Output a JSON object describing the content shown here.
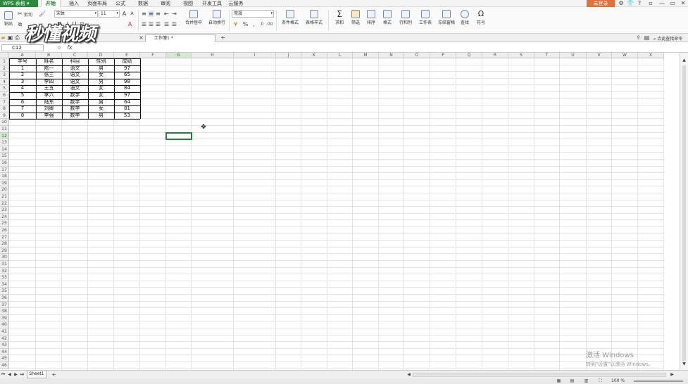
{
  "app": {
    "brand": "WPS 表格",
    "login": "未登录"
  },
  "menu": [
    "开始",
    "插入",
    "页面布局",
    "公式",
    "数据",
    "审阅",
    "视图",
    "开发工具",
    "云服务"
  ],
  "window_controls": [
    "—",
    "▭",
    "✕"
  ],
  "ribbon": {
    "paste": "粘贴",
    "cut": "剪切",
    "copy": "复制",
    "format_painter": "格式刷",
    "font_name": "宋体",
    "font_size": "11",
    "bold": "B",
    "italic": "I",
    "underline": "U",
    "merge_center": "合并居中",
    "auto_wrap": "自动换行",
    "number_format": "常规",
    "percent": "%",
    "conditional_format": "条件格式",
    "table_style": "表格样式",
    "sum": "求和",
    "filter": "筛选",
    "sort": "排序",
    "format": "格式",
    "row_col": "行和列",
    "worksheet": "工作表",
    "freeze": "冻结窗格",
    "find": "查找",
    "symbol": "符号"
  },
  "tabs": {
    "document": "工作簿1 *",
    "add": "+",
    "search_command": "点此查找命令"
  },
  "watermark": "秒懂视频",
  "formula_bar": {
    "cell_ref": "C12",
    "fx": "fx",
    "value": ""
  },
  "columns": [
    "A",
    "B",
    "C",
    "D",
    "E",
    "F",
    "G",
    "H",
    "I",
    "J",
    "K",
    "L",
    "M",
    "N",
    "O",
    "P",
    "Q",
    "R",
    "S",
    "T",
    "U",
    "V",
    "W",
    "X"
  ],
  "rows": [
    "1",
    "2",
    "3",
    "4",
    "5",
    "6",
    "7",
    "8",
    "9",
    "10",
    "11",
    "12",
    "13",
    "14",
    "15",
    "16",
    "17",
    "18",
    "19",
    "20",
    "21",
    "22",
    "23",
    "24",
    "25",
    "26",
    "27",
    "28",
    "29",
    "30",
    "31",
    "32",
    "33",
    "34",
    "35",
    "36",
    "37",
    "38",
    "39",
    "40",
    "41",
    "42",
    "43",
    "44",
    "45",
    "46"
  ],
  "table": {
    "headers": [
      "学号",
      "姓名",
      "科目",
      "性别",
      "成绩"
    ],
    "rows": [
      [
        "1",
        "陈一",
        "语文",
        "男",
        "97"
      ],
      [
        "2",
        "张三",
        "语文",
        "女",
        "65"
      ],
      [
        "3",
        "李四",
        "语文",
        "男",
        "98"
      ],
      [
        "4",
        "王五",
        "语文",
        "女",
        "84"
      ],
      [
        "5",
        "李六",
        "数学",
        "女",
        "97"
      ],
      [
        "6",
        "陆东",
        "数学",
        "男",
        "64"
      ],
      [
        "7",
        "刘卿",
        "数学",
        "女",
        "81"
      ],
      [
        "8",
        "李强",
        "数学",
        "男",
        "53"
      ]
    ]
  },
  "selected_cell": "G12",
  "sheet": {
    "name": "Sheet1",
    "add": "+"
  },
  "status": {
    "zoom": "100 %"
  },
  "activation": {
    "title": "激活 Windows",
    "subtitle": "转到\"设置\"以激活 Windows。"
  }
}
